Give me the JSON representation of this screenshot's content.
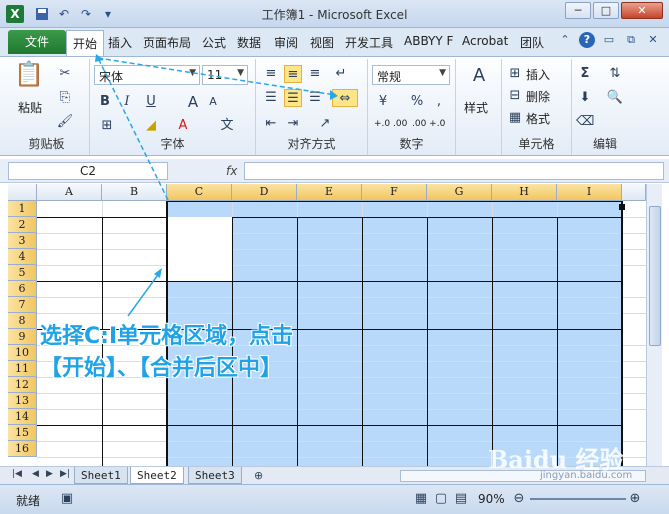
{
  "window": {
    "title": "工作簿1 - Microsoft Excel",
    "minimize": "─",
    "restore": "□",
    "close": "✕"
  },
  "quick_access": {
    "app_icon": "X",
    "save": "save-icon",
    "undo": "undo-icon",
    "redo": "redo-icon"
  },
  "ribbon_tabs": {
    "file": "文件",
    "items": [
      "开始",
      "插入",
      "页面布局",
      "公式",
      "数据",
      "审阅",
      "视图",
      "开发工具",
      "ABBYY F",
      "Acrobat",
      "团队"
    ]
  },
  "ribbon": {
    "clipboard": {
      "paste": "粘贴",
      "label": "剪贴板"
    },
    "font": {
      "font_name": "宋体",
      "font_size": "11",
      "bold": "B",
      "italic": "I",
      "underline": "U",
      "label": "字体"
    },
    "alignment": {
      "label": "对齐方式"
    },
    "number": {
      "format": "常规",
      "percent": "%",
      "comma": ",",
      "increase": "+.0 .00",
      "decrease": ".00 +.0",
      "label": "数字"
    },
    "styles": {
      "label": "样式"
    },
    "cells": {
      "insert": "插入",
      "delete": "删除",
      "format": "格式",
      "label": "单元格"
    },
    "editing": {
      "label": "编辑"
    }
  },
  "formula_bar": {
    "name_box": "C2",
    "fx": "fx",
    "value": ""
  },
  "grid": {
    "columns": [
      "A",
      "B",
      "C",
      "D",
      "E",
      "F",
      "G",
      "H",
      "I"
    ],
    "rows": [
      "1",
      "2",
      "3",
      "4",
      "5",
      "6",
      "7",
      "8",
      "9",
      "10",
      "11",
      "12",
      "13",
      "14",
      "15",
      "16"
    ],
    "selection": "C2:I16",
    "selection_color": "#b8d9fa"
  },
  "sheets": {
    "tabs": [
      "Sheet1",
      "Sheet2",
      "Sheet3"
    ],
    "active": "Sheet2"
  },
  "statusbar": {
    "mode": "就绪",
    "zoom": "90%"
  },
  "annotation": {
    "line1": "选择C:I单元格区域，点击",
    "line2": "【开始】、【合并后区中】",
    "color": "#1fa3e6"
  },
  "watermark": {
    "text": "Baidu 经验",
    "sub": "jingyan.baidu.com"
  }
}
